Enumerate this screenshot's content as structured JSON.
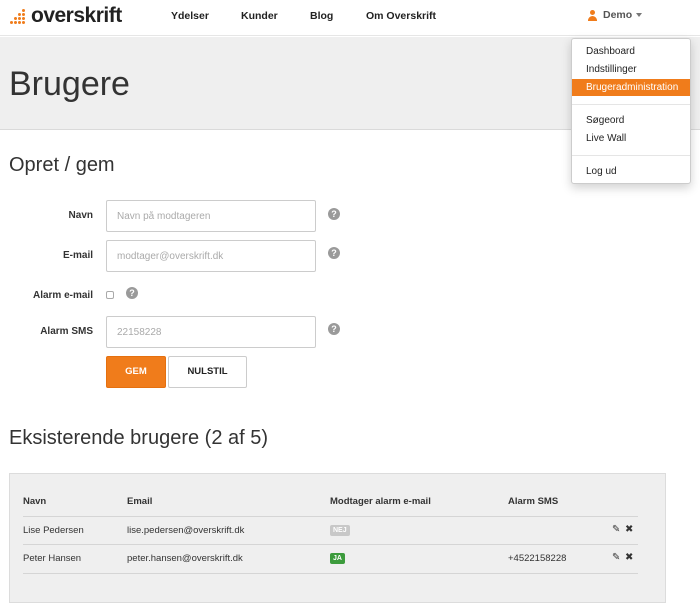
{
  "navbar": {
    "logo_text": "overskrift",
    "links": [
      "Ydelser",
      "Kunder",
      "Blog",
      "Om Overskrift"
    ],
    "user_label": "Demo"
  },
  "dropdown": {
    "items": [
      "Dashboard",
      "Indstillinger",
      "Brugeradministration",
      "Søgeord",
      "Live Wall",
      "Log ud"
    ],
    "active_item": "Brugeradministration"
  },
  "page": {
    "title": "Brugere"
  },
  "form": {
    "section_title": "Opret / gem",
    "name_label": "Navn",
    "name_placeholder": "Navn på modtageren",
    "email_label": "E-mail",
    "email_placeholder": "modtager@overskrift.dk",
    "alarm_email_label": "Alarm e-mail",
    "alarm_email_checked": false,
    "sms_label": "Alarm SMS",
    "sms_placeholder": "22158228",
    "help_glyph": "?",
    "save_label": "GEM",
    "reset_label": "NULSTIL"
  },
  "users": {
    "section_title": "Eksisterende brugere (2 af 5)",
    "columns": [
      "Navn",
      "Email",
      "Modtager alarm e-mail",
      "Alarm SMS"
    ],
    "rows": [
      {
        "name": "Lise Pedersen",
        "email": "lise.pedersen@overskrift.dk",
        "alarm_email": "NEJ",
        "sms": ""
      },
      {
        "name": "Peter Hansen",
        "email": "peter.hansen@overskrift.dk",
        "alarm_email": "JA",
        "sms": "+4522158228"
      }
    ],
    "edit_glyph": "✎",
    "delete_glyph": "✖"
  },
  "colors": {
    "accent": "#f07c1b",
    "badge_yes": "#3c9b3c",
    "badge_no": "#c8c8c8",
    "header_bg": "#efefef"
  }
}
